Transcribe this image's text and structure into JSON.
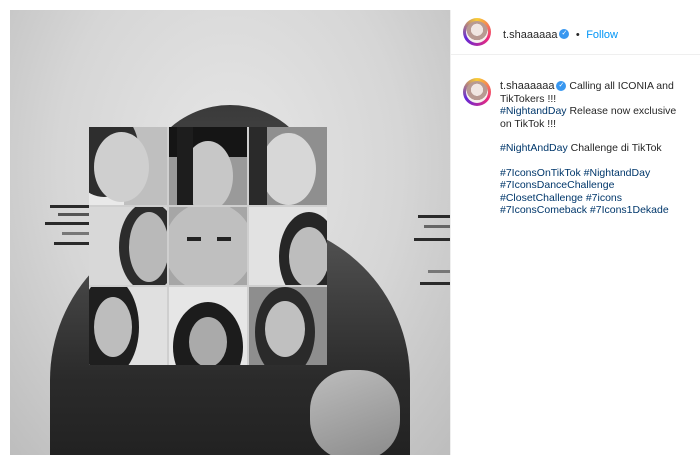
{
  "post": {
    "username": "t.shaaaaaa",
    "follow_label": "Follow",
    "separator": "•"
  },
  "caption": {
    "username": "t.shaaaaaa",
    "text_1": "Calling all ICONIA and TikTokers !!!",
    "hashtag_1": "#NightandDay",
    "text_2": " Release now exclusive on TikTok !!!",
    "hashtag_2": "#NightAndDay",
    "text_3": " Challenge di TikTok",
    "tags": [
      "#7IconsOnTikTok",
      "#NightandDay",
      "#7IconsDanceChallenge",
      "#ClosetChallenge",
      "#7icons",
      "#7IconsComeback",
      "#7Icons1Dekade"
    ]
  },
  "icons": {
    "verified": "verified-badge-icon",
    "avatar": "profile-avatar"
  },
  "colors": {
    "link": "#0095f6",
    "hashtag": "#00376b",
    "text": "#262626"
  }
}
